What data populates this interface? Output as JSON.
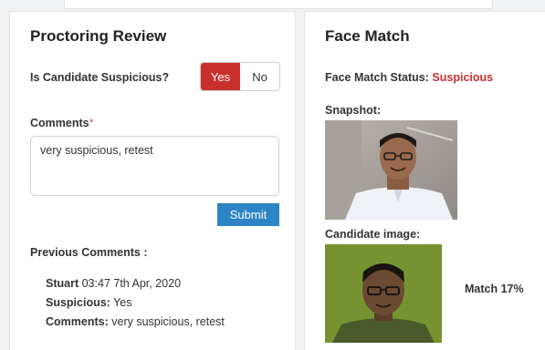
{
  "proctoring": {
    "title": "Proctoring Review",
    "suspicious_question": "Is Candidate Suspicious?",
    "yes_label": "Yes",
    "no_label": "No",
    "selected": "Yes",
    "comments_label": "Comments",
    "required_mark": "*",
    "comment_value": "very suspicious, retest",
    "submit_label": "Submit",
    "previous_title": "Previous Comments :",
    "previous": {
      "author": "Stuart",
      "timestamp": "03:47 7th Apr, 2020",
      "suspicious_label": "Suspicious:",
      "suspicious_value": "Yes",
      "comments_label": "Comments:",
      "comments_value": "very suspicious, retest"
    }
  },
  "face_match": {
    "title": "Face Match",
    "status_label": "Face Match Status:",
    "status_value": "Suspicious",
    "snapshot_label": "Snapshot:",
    "candidate_label": "Candidate image:",
    "match_text": "Match 17%"
  },
  "colors": {
    "danger": "#c9302c",
    "primary": "#2d84c4"
  }
}
